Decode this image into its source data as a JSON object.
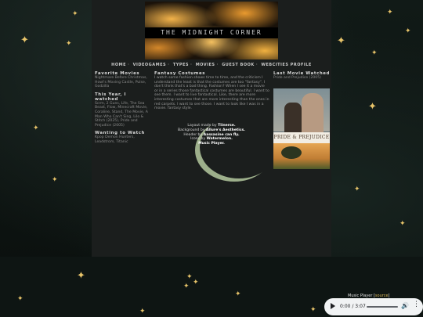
{
  "banner": {
    "title": "THE MIDNIGHT CORNER"
  },
  "nav": {
    "items": [
      "HOME",
      "VIDEOGAMES",
      "TYPES",
      "MOVIES",
      "GUEST BOOK",
      "WEBCITIES PROFILE"
    ]
  },
  "left": {
    "favorite_heading": "Favorite Movies",
    "favorite_text": "Nightmare Before Christmas, Howl's Moving Castle, Pulse, Godzilla",
    "year_heading": "This Year, I watched",
    "year_text": "Scrm, 2 Guns, Life, The Sea Beast, Flow, Minecraft Movie, Coraline, Stand, The Movie, A Man Who Can't Sing, Lilo & Stitch (2025), Pride and Prejudice (2005)",
    "wanting_heading": "Wanting to Watch",
    "wanting_text": "Kpop Demon Hunters, Leadstrom, Titanic"
  },
  "mid": {
    "heading": "Fantasy Costumes",
    "body": "I watch some fashion shows time to time, and the criticism I understand the least is that the costumes are too \"fantasy\". I don't think that's a bad thing. Fashion? When I see it a movie or in a series those fantastical costumes are beautiful. I want to see them. I want to live fantastical. Like, there are more interesting costumes that are more interesting than the ones in red carpets. I want to see those. I want to look like I was in a movie. fantasy style."
  },
  "credits": {
    "line1_prefix": "Layout made by",
    "line1_name": "Tiinerse.",
    "line2_prefix": "Background by",
    "line2_name": "Allure's Aesthetics.",
    "line3_prefix": "Header by",
    "line3_name": "Aassasine can fly.",
    "line4_prefix": "Icons by",
    "line4_name": "Watermelon.",
    "line5": "Music Player."
  },
  "right": {
    "heading": "Last Movie Watched",
    "movie": "Pride and Prejudice (2005)",
    "poster_title": "PRIDE & PREJUDICE"
  },
  "player": {
    "label": "Music Player",
    "source_label": "source",
    "time": "0:00 / 3:07"
  },
  "colors": {
    "accent_gold": "#e8c46a",
    "panel": "#1b1e1d",
    "background": "#0b1110"
  }
}
